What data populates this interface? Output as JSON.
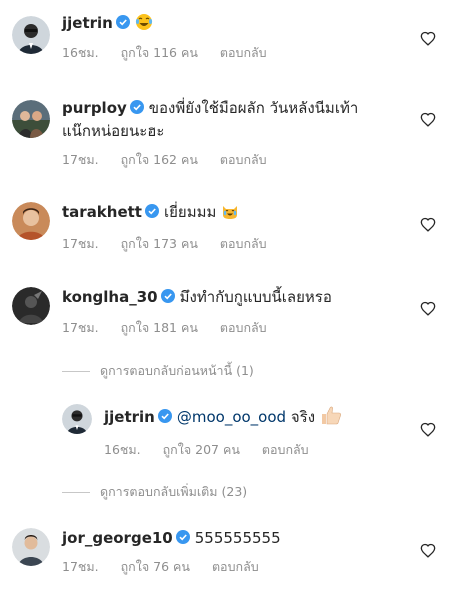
{
  "comments": [
    {
      "username": "jjetrin",
      "text": "",
      "emoji": "laugh-cry",
      "time": "16ชม.",
      "likes": "ถูกใจ 116 คน",
      "reply": "ตอบกลับ"
    },
    {
      "username": "purploy",
      "text": "ของพี่ยังใช้มือผลัก วันหลังนีมเท้า",
      "text2": "แน๊กหน่อยนะฮะ",
      "time": "17ชม.",
      "likes": "ถูกใจ 162 คน",
      "reply": "ตอบกลับ"
    },
    {
      "username": "tarakhett",
      "text": "เยี่ยมมม",
      "emoji": "crying-laugh-cat",
      "time": "17ชม.",
      "likes": "ถูกใจ 173 คน",
      "reply": "ตอบกลับ"
    },
    {
      "username": "konglha_30",
      "text": "มึงทำกับกูแบบนี้เลยหรอ",
      "time": "17ชม.",
      "likes": "ถูกใจ 181 คน",
      "reply": "ตอบกลับ"
    },
    {
      "username": "jjetrin",
      "mention": "@moo_oo_ood",
      "text": "จริง",
      "emoji": "thumbs-up",
      "time": "16ชม.",
      "likes": "ถูกใจ 207 คน",
      "reply": "ตอบกลับ"
    },
    {
      "username": "jor_george10",
      "text": "555555555",
      "time": "17ชม.",
      "likes": "ถูกใจ 76 คน",
      "reply": "ตอบกลับ"
    }
  ],
  "view_previous": "ดูการตอบกลับก่อนหน้านี้ (1)",
  "view_more": "ดูการตอบกลับเพิ่มเติม (23)",
  "colors": {
    "verified": "#3897f0",
    "meta": "#8e8e8e",
    "text": "#262626",
    "divider": "#c7c7c7"
  }
}
